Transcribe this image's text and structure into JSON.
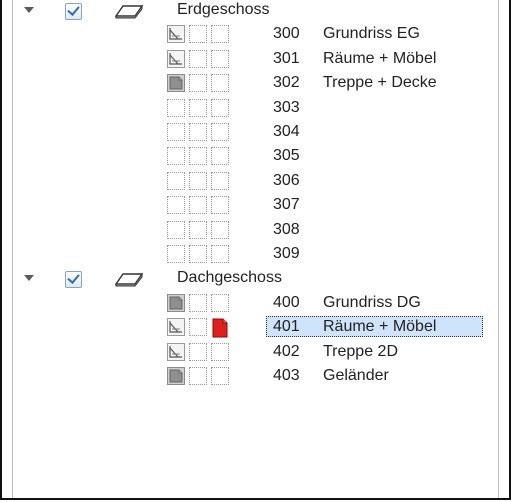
{
  "groups": [
    {
      "label": "Erdgeschoss",
      "expanded": true,
      "checked": true,
      "expander_icon": "chevron-down-icon",
      "layer_icon": "layer-icon",
      "rows": [
        {
          "number": "300",
          "name": "Grundriss EG",
          "icon": "plan-icon"
        },
        {
          "number": "301",
          "name": "Räume + Möbel",
          "icon": "plan-icon"
        },
        {
          "number": "302",
          "name": "Treppe + Decke",
          "icon": "document-icon"
        },
        {
          "number": "303",
          "name": "",
          "icon": ""
        },
        {
          "number": "304",
          "name": "",
          "icon": ""
        },
        {
          "number": "305",
          "name": "",
          "icon": ""
        },
        {
          "number": "306",
          "name": "",
          "icon": ""
        },
        {
          "number": "307",
          "name": "",
          "icon": ""
        },
        {
          "number": "308",
          "name": "",
          "icon": ""
        },
        {
          "number": "309",
          "name": "",
          "icon": ""
        }
      ]
    },
    {
      "label": "Dachgeschoss",
      "expanded": true,
      "checked": true,
      "expander_icon": "chevron-down-icon",
      "layer_icon": "layer-icon",
      "rows": [
        {
          "number": "400",
          "name": "Grundriss DG",
          "icon": "document-icon"
        },
        {
          "number": "401",
          "name": "Räume + Möbel",
          "icon": "plan-icon",
          "extra_icon": "red-document-icon",
          "selected": true
        },
        {
          "number": "402",
          "name": "Treppe 2D",
          "icon": "plan-icon"
        },
        {
          "number": "403",
          "name": "Geländer",
          "icon": "document-icon"
        }
      ]
    }
  ],
  "colors": {
    "selection": "#cfe3fa",
    "checkbox_tick": "#2f6fbd",
    "red_icon": "#e0201b"
  }
}
